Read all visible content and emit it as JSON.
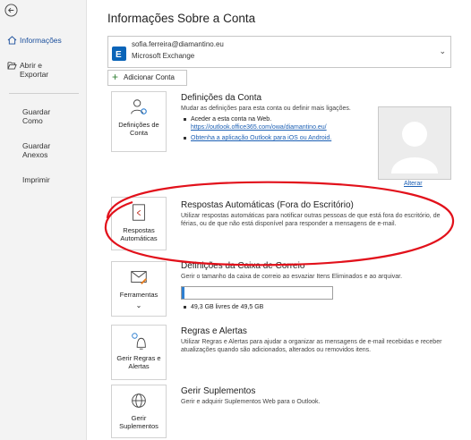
{
  "sidebar": {
    "items": [
      {
        "label": "Informações"
      },
      {
        "label": "Abrir e Exportar"
      },
      {
        "label": "Guardar Como"
      },
      {
        "label": "Guardar Anexos"
      },
      {
        "label": "Imprimir"
      }
    ]
  },
  "main": {
    "title": "Informações Sobre a Conta",
    "account": {
      "email": "sofia.ferreira@diamantino.eu",
      "type": "Microsoft Exchange"
    },
    "add_account_label": "Adicionar Conta",
    "account_settings": {
      "tile_label": "Definições de Conta",
      "title": "Definições da Conta",
      "description": "Mudar as definições para esta conta ou definir mais ligações.",
      "bullet1": "Aceder a esta conta na Web.",
      "link1": "https://outlook.office365.com/owa/diamantino.eu/",
      "bullet2_link": "Obtenha a aplicação Outlook para iOS ou Android.",
      "change_photo": "Alterar"
    },
    "auto_replies": {
      "tile_label": "Respostas Automáticas",
      "title": "Respostas Automáticas (Fora do Escritório)",
      "description": "Utilizar respostas automáticas para notificar outras pessoas de que está fora do escritório, de férias, ou de que não está disponível para responder a mensagens de e-mail."
    },
    "mailbox": {
      "tile_label": "Ferramentas",
      "title": "Definições da Caixa de Correio",
      "description": "Gerir o tamanho da caixa de correio ao esvaziar Itens Eliminados e ao arquivar.",
      "usage_fraction": 0.016,
      "usage_text": "49,3 GB livres de 49,5 GB"
    },
    "rules": {
      "tile_label": "Gerir Regras e Alertas",
      "title": "Regras e Alertas",
      "description": "Utilizar Regras e Alertas para ajudar a organizar as mensagens de e-mail recebidas e receber atualizações quando são adicionados, alterados ou removidos itens."
    },
    "addins": {
      "tile_label": "Gerir Suplementos",
      "title": "Gerir Suplementos",
      "description": "Gerir e adquirir Suplementos Web para o Outlook."
    }
  },
  "colors": {
    "accent": "#1b5fb4",
    "annotation_ring": "#e2111b",
    "exchange_blue": "#0a64b8"
  }
}
